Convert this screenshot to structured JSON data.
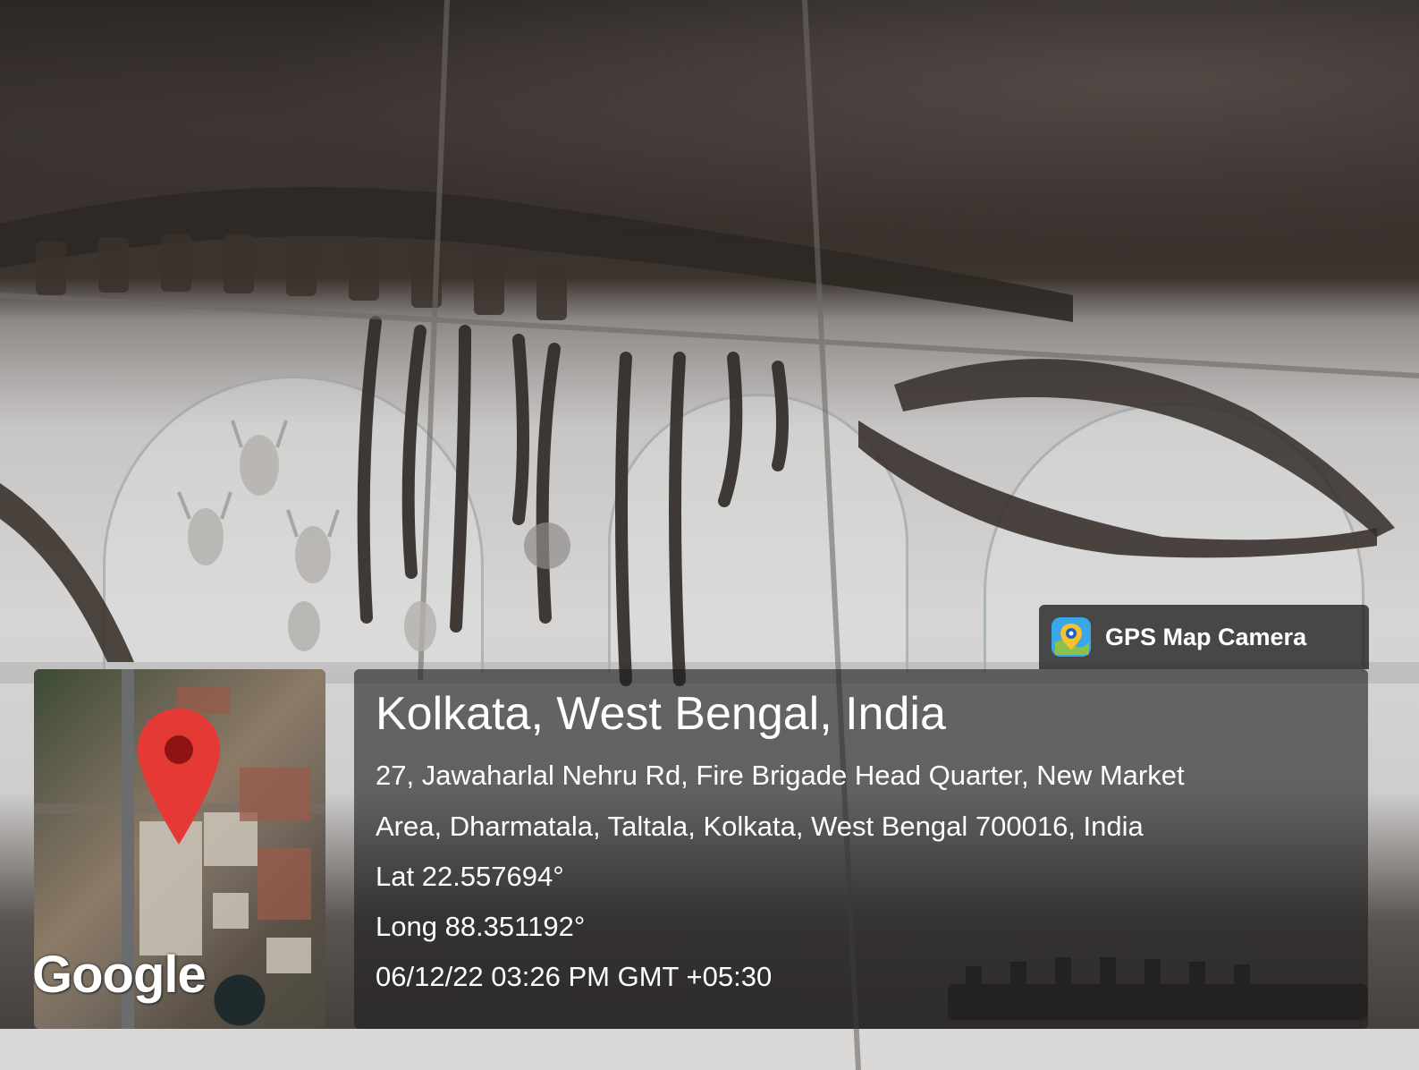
{
  "stamp": {
    "app_name": "GPS Map Camera",
    "icon": "gps-map-camera-icon",
    "location_title": "Kolkata, West Bengal, India",
    "address_line1": "27, Jawaharlal Nehru Rd, Fire Brigade Head Quarter, New Market",
    "address_line2": "Area, Dharmatala, Taltala, Kolkata, West Bengal 700016, India",
    "latitude": "Lat 22.557694°",
    "longitude": "Long 88.351192°",
    "datetime": "06/12/22 03:26 PM GMT +05:30"
  },
  "map": {
    "logo_text": "Google",
    "pin_icon": "map-pin-icon",
    "pin_color": "#e53935"
  }
}
